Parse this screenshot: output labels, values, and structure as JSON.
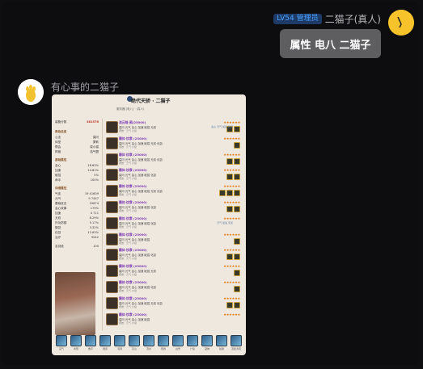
{
  "self": {
    "level_badge": "LV54 管理员",
    "name": "二猫子(真人)",
    "message": "属性 电八 二猫子"
  },
  "bot": {
    "name": "有心事的二猫子"
  },
  "card": {
    "title": "绝代天骄 · 二猫子",
    "subtitle": "服务器 [电八] · (真人)",
    "left_panel": {
      "score_label": "装备分数",
      "score_value": "381576",
      "sections": [
        {
          "title": "角色信息",
          "rows": [
            [
              "心法",
              "莫问"
            ],
            [
              "体型",
              "萝莉"
            ],
            [
              "帮会",
              "菜小猫"
            ],
            [
              "阵营",
              "浩气盟"
            ]
          ]
        },
        {
          "title": "基础属性",
          "rows": [
            [
              "会心",
              "18.63%"
            ],
            [
              "加速",
              "14.81%"
            ],
            [
              "破招",
              "5%"
            ],
            [
              "命中",
              "100%"
            ]
          ]
        },
        {
          "title": "详细属性",
          "rows": [
            [
              "气血",
              "19 41609"
            ],
            [
              "元气",
              "9 7447"
            ],
            [
              "基础攻击",
              "29874"
            ],
            [
              "会心效果",
              "179%"
            ],
            [
              "加速",
              "4 711"
            ],
            [
              "无双",
              "8.29%"
            ],
            [
              "外功防御",
              "5.17%"
            ],
            [
              "御劲",
              "3.32%"
            ],
            [
              "化劲",
              "12.63%"
            ],
            [
              "治疗",
              "9042"
            ]
          ]
        }
      ],
      "rank_label": "名剑段",
      "rank_value": "100"
    },
    "equipments": [
      {
        "name": "流云暗·鸦(25000)",
        "desc": "莫问 元气 会心 加速 破招 无双",
        "desc2": "镶嵌：元气·六级",
        "stars": "★★★★★★",
        "tags": 2,
        "extra": "会心 元气 加速 破招"
      },
      {
        "name": "霸体·纹章 (25000)",
        "desc": "莫问 元气 会心 加速 破招 无双 化劲",
        "desc2": "镶嵌：元气·六级",
        "stars": "★★★★★★",
        "tags": 1,
        "extra": ""
      },
      {
        "name": "霸体·纹章 (25000)",
        "desc": "莫问 元气 会心 加速 破招 无双 化劲",
        "desc2": "镶嵌：元气·六级",
        "stars": "★★★★★★",
        "tags": 2,
        "extra": ""
      },
      {
        "name": "霸体·纹章 (25000)",
        "desc": "莫问 元气 会心 加速 破招 化劲",
        "desc2": "镶嵌：元气·六级",
        "stars": "★★★★★★",
        "tags": 2,
        "extra": ""
      },
      {
        "name": "霸体·纹章 (25000)",
        "desc": "莫问 元气 会心 加速 破招 无双 化劲",
        "desc2": "镶嵌：元气·六级",
        "stars": "★★★★★★",
        "tags": 3,
        "extra": ""
      },
      {
        "name": "霸体·纹章 (25000)",
        "desc": "莫问 元气 会心 加速 破招 化劲",
        "desc2": "镶嵌：元气·六级",
        "stars": "★★★★★★",
        "tags": 2,
        "extra": ""
      },
      {
        "name": "霸体·纹章 (25000)",
        "desc": "莫问 元气 会心 加速 破招 化劲",
        "desc2": "镶嵌：元气·六级",
        "stars": "★★★★★★",
        "tags": 0,
        "extra": "元气 加速 无双"
      },
      {
        "name": "霸体·纹章 (25000)",
        "desc": "莫问 元气 会心 加速 破招",
        "desc2": "镶嵌：元气·六级",
        "stars": "★★★★★★",
        "tags": 1,
        "extra": ""
      },
      {
        "name": "霸体·纹章 (25000)",
        "desc": "莫问 元气 会心 加速 破招 化劲",
        "desc2": "镶嵌：元气·六级",
        "stars": "★★★★★★",
        "tags": 2,
        "extra": ""
      },
      {
        "name": "霸体·纹章 (25000)",
        "desc": "莫问 元气 会心 加速 破招 无双",
        "desc2": "镶嵌：元气·六级",
        "stars": "★★★★★★",
        "tags": 1,
        "extra": ""
      },
      {
        "name": "霸体·纹章 (25000)",
        "desc": "莫问 元气 会心 加速 破招 化劲",
        "desc2": "镶嵌：元气·六级",
        "stars": "★★★★★★",
        "tags": 1,
        "extra": ""
      },
      {
        "name": "霸体·纹章 (25000)",
        "desc": "莫问 元气 会心 加速 破招 无双 化劲",
        "desc2": "镶嵌：元气·六级",
        "stars": "★★★★★★",
        "tags": 2,
        "extra": ""
      },
      {
        "name": "霸体·纹章 (25000)",
        "desc": "莫问 元气 会心 加速 破招",
        "desc2": "镶嵌：元气·六级",
        "stars": "★★★★★★",
        "tags": 0,
        "extra": ""
      }
    ],
    "skills": [
      "宫气",
      "商阳",
      "角声",
      "徵音",
      "羽调",
      "高山",
      "流水",
      "阳春",
      "白雪",
      "广陵",
      "凝神",
      "弦歌",
      "双弦清音"
    ]
  }
}
